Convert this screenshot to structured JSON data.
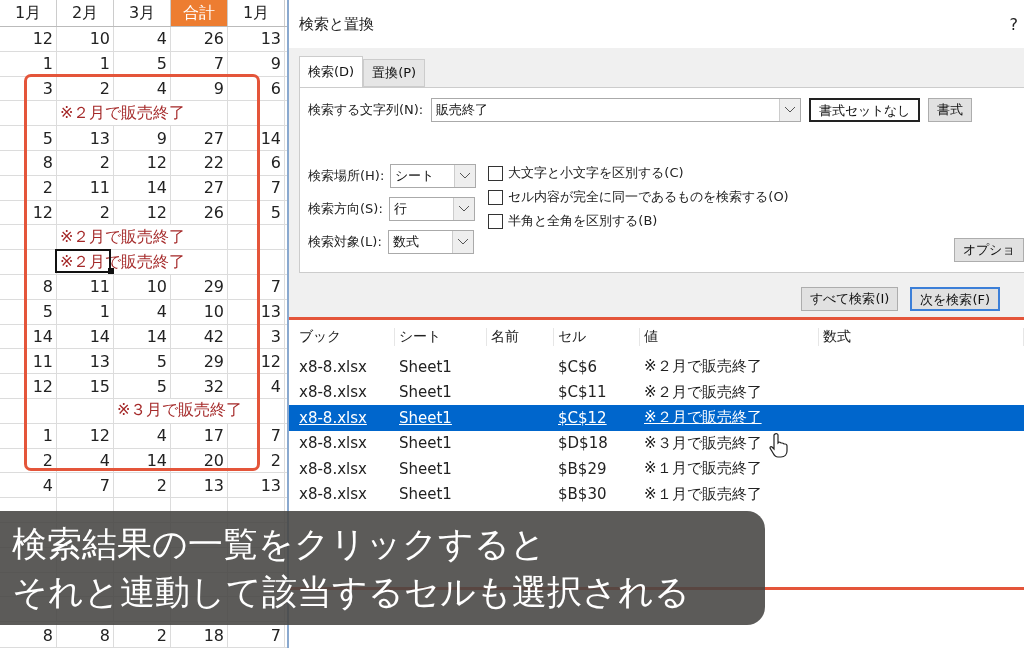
{
  "sheet": {
    "columns": [
      {
        "label": "1月",
        "highlighted": false
      },
      {
        "label": "2月",
        "highlighted": false
      },
      {
        "label": "3月",
        "highlighted": false
      },
      {
        "label": "合計",
        "highlighted": true
      },
      {
        "label": "1月",
        "highlighted": false
      }
    ],
    "rows": [
      {
        "kind": "values",
        "cells": [
          "12",
          "10",
          "4",
          "26",
          "13"
        ]
      },
      {
        "kind": "values",
        "cells": [
          "1",
          "1",
          "5",
          "7",
          "9"
        ]
      },
      {
        "kind": "values",
        "cells": [
          "3",
          "2",
          "4",
          "9",
          "6"
        ]
      },
      {
        "kind": "note",
        "text": "※２月で販売終了",
        "active": false
      },
      {
        "kind": "values",
        "cells": [
          "5",
          "13",
          "9",
          "27",
          "14"
        ]
      },
      {
        "kind": "values",
        "cells": [
          "8",
          "2",
          "12",
          "22",
          "6"
        ]
      },
      {
        "kind": "values",
        "cells": [
          "2",
          "11",
          "14",
          "27",
          "7"
        ]
      },
      {
        "kind": "values",
        "cells": [
          "12",
          "2",
          "12",
          "26",
          "5"
        ]
      },
      {
        "kind": "note",
        "text": "※２月で販売終了",
        "active": false
      },
      {
        "kind": "note",
        "text": "※２月で販売終了",
        "active": true
      },
      {
        "kind": "values",
        "cells": [
          "8",
          "11",
          "10",
          "29",
          "7"
        ]
      },
      {
        "kind": "values",
        "cells": [
          "5",
          "1",
          "4",
          "10",
          "13"
        ]
      },
      {
        "kind": "values",
        "cells": [
          "14",
          "14",
          "14",
          "42",
          "3"
        ]
      },
      {
        "kind": "values",
        "cells": [
          "11",
          "13",
          "5",
          "29",
          "12"
        ]
      },
      {
        "kind": "values",
        "cells": [
          "12",
          "15",
          "5",
          "32",
          "4"
        ]
      },
      {
        "kind": "latenote",
        "text": "※３月で販売終了",
        "active": false
      },
      {
        "kind": "values",
        "cells": [
          "1",
          "12",
          "4",
          "17",
          "7"
        ]
      },
      {
        "kind": "values",
        "cells": [
          "2",
          "4",
          "14",
          "20",
          "2"
        ]
      },
      {
        "kind": "values",
        "cells": [
          "4",
          "7",
          "2",
          "13",
          "13"
        ]
      }
    ],
    "last_row": {
      "cells": [
        "8",
        "8",
        "2",
        "18",
        "7"
      ]
    }
  },
  "dialog": {
    "title": "検索と置換",
    "help": "?",
    "tabs": [
      {
        "label": "検索(D)",
        "selected": true
      },
      {
        "label": "置換(P)",
        "selected": false
      }
    ],
    "find": {
      "label": "検索する文字列(N):",
      "value": "販売終了"
    },
    "format_buttons": [
      "書式セットなし",
      "書式"
    ],
    "dropdowns": [
      {
        "label": "検索場所(H):",
        "value": "シート"
      },
      {
        "label": "検索方向(S):",
        "value": "行"
      },
      {
        "label": "検索対象(L):",
        "value": "数式"
      }
    ],
    "checkboxes": [
      {
        "label": "大文字と小文字を区別する(C)",
        "checked": false
      },
      {
        "label": "セル内容が完全に同一であるものを検索する(O)",
        "checked": false
      },
      {
        "label": "半角と全角を区別する(B)",
        "checked": false
      }
    ],
    "options_button": "オプショ",
    "action_buttons": [
      {
        "label": "すべて検索(I)",
        "focused": false
      },
      {
        "label": "次を検索(F)",
        "focused": true
      }
    ],
    "results": {
      "columns": [
        "ブック",
        "シート",
        "名前",
        "セル",
        "値",
        "数式"
      ],
      "rows": [
        {
          "book": "x8-8.xlsx",
          "sheet": "Sheet1",
          "cell": "$C$6",
          "value": "※２月で販売終了",
          "selected": false
        },
        {
          "book": "x8-8.xlsx",
          "sheet": "Sheet1",
          "cell": "$C$11",
          "value": "※２月で販売終了",
          "selected": false
        },
        {
          "book": "x8-8.xlsx",
          "sheet": "Sheet1",
          "cell": "$C$12",
          "value": "※２月で販売終了",
          "selected": true
        },
        {
          "book": "x8-8.xlsx",
          "sheet": "Sheet1",
          "cell": "$D$18",
          "value": "※３月で販売終了",
          "selected": false
        },
        {
          "book": "x8-8.xlsx",
          "sheet": "Sheet1",
          "cell": "$B$29",
          "value": "※１月で販売終了",
          "selected": false
        },
        {
          "book": "x8-8.xlsx",
          "sheet": "Sheet1",
          "cell": "$B$30",
          "value": "※１月で販売終了",
          "selected": false
        }
      ]
    }
  },
  "caption": [
    "検索結果の一覧をクリックすると",
    "それと連動して該当するセルも選択される"
  ]
}
